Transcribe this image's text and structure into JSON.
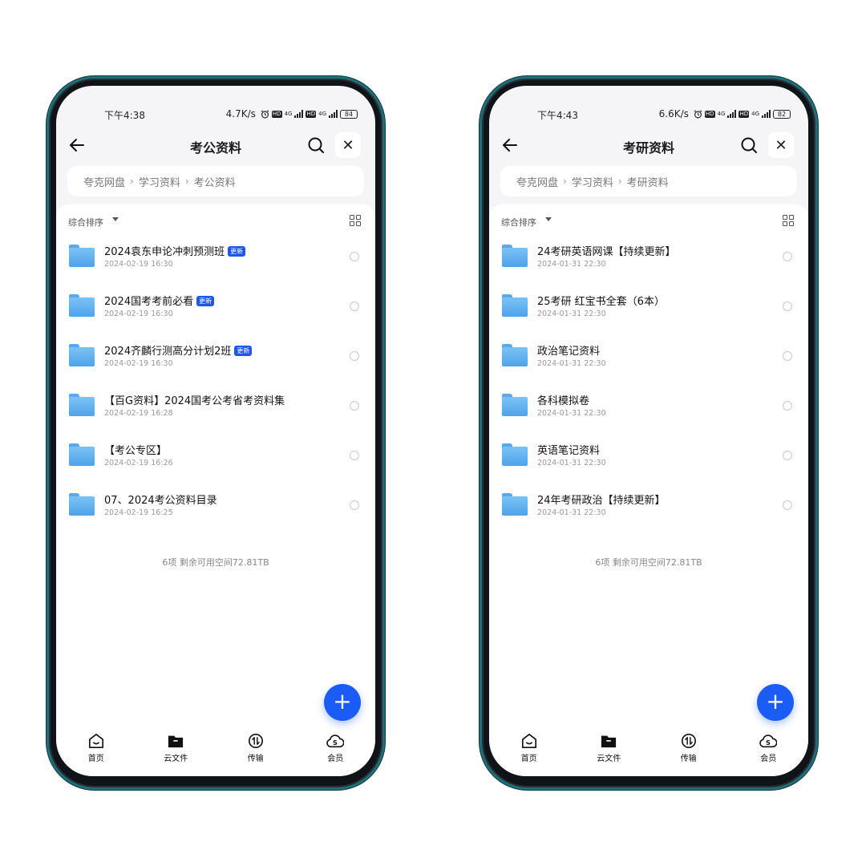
{
  "phones": [
    {
      "status": {
        "time": "下午4:38",
        "speed": "4.7K/s",
        "battery": "84",
        "net1": "4G",
        "net2": "4G"
      },
      "title": "考公资料",
      "close_label": "✕",
      "breadcrumb": [
        "夸克网盘",
        "学习资料",
        "考公资料"
      ],
      "sort_label": "综合排序",
      "files": [
        {
          "name": "2024袁东申论冲刺预测班",
          "date": "2024-02-19 16:30",
          "badge": "更新"
        },
        {
          "name": "2024国考考前必看",
          "date": "2024-02-19 16:30",
          "badge": "更新"
        },
        {
          "name": "2024齐麟行测高分计划2班",
          "date": "2024-02-19 16:30",
          "badge": "更新"
        },
        {
          "name": "【百G资料】2024国考公考省考资料集",
          "date": "2024-02-19 16:28",
          "badge": ""
        },
        {
          "name": "【考公专区】",
          "date": "2024-02-19 16:26",
          "badge": ""
        },
        {
          "name": "07、2024考公资料目录",
          "date": "2024-02-19 16:25",
          "badge": ""
        }
      ],
      "footer": "6项 剩余可用空间72.81TB",
      "fab": "+",
      "tabs": [
        "首页",
        "云文件",
        "传输",
        "会员"
      ]
    },
    {
      "status": {
        "time": "下午4:43",
        "speed": "6.6K/s",
        "battery": "82",
        "net1": "4G",
        "net2": "4G"
      },
      "title": "考研资料",
      "close_label": "✕",
      "breadcrumb": [
        "夸克网盘",
        "学习资料",
        "考研资料"
      ],
      "sort_label": "综合排序",
      "files": [
        {
          "name": "24考研英语网课【持续更新】",
          "date": "2024-01-31 22:30",
          "badge": ""
        },
        {
          "name": "25考研 红宝书全套（6本）",
          "date": "2024-01-31 22:30",
          "badge": ""
        },
        {
          "name": "政治笔记资料",
          "date": "2024-01-31 22:30",
          "badge": ""
        },
        {
          "name": "各科模拟卷",
          "date": "2024-01-31 22:30",
          "badge": ""
        },
        {
          "name": "英语笔记资料",
          "date": "2024-01-31 22:30",
          "badge": ""
        },
        {
          "name": "24年考研政治【持续更新】",
          "date": "2024-01-31 22:30",
          "badge": ""
        }
      ],
      "footer": "6项 剩余可用空间72.81TB",
      "fab": "+",
      "tabs": [
        "首页",
        "云文件",
        "传输",
        "会员"
      ]
    }
  ],
  "colors": {
    "accent": "#1a5cf5",
    "badge": "#1f56e8",
    "folder": "#5aa9ec",
    "frame": "#1f6f7a"
  },
  "icons": [
    "back-arrow-icon",
    "search-icon",
    "close-icon",
    "grid-view-icon",
    "folder-icon",
    "home-icon",
    "cloud-folder-icon",
    "transfer-icon",
    "vip-icon",
    "plus-icon"
  ]
}
